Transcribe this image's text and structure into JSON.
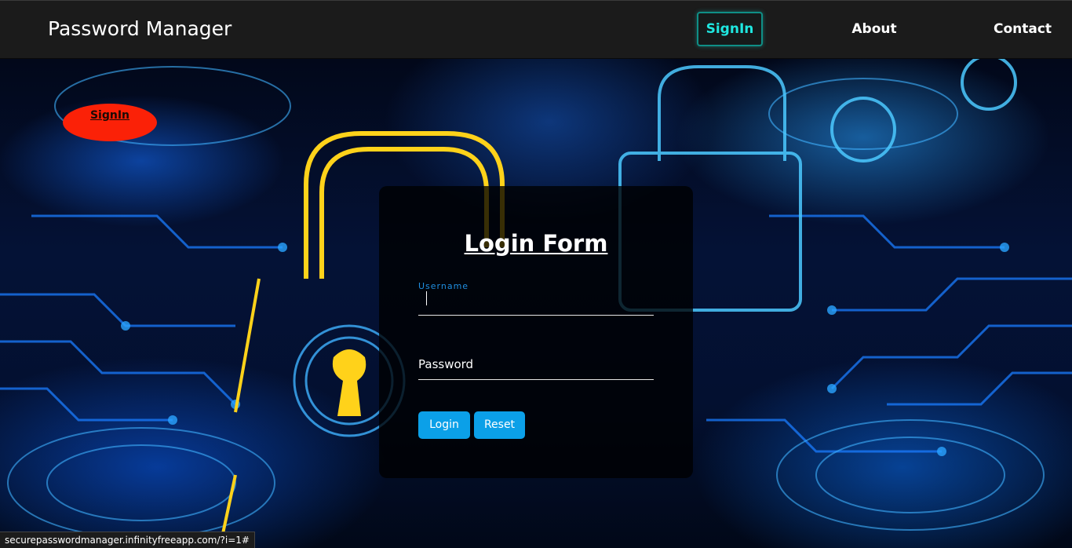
{
  "navbar": {
    "brand": "Password Manager",
    "links": [
      {
        "label": "SignIn",
        "active": true
      },
      {
        "label": "About",
        "active": false
      },
      {
        "label": "Contact",
        "active": false
      }
    ]
  },
  "badge": {
    "label": "SignIn",
    "color": "#fb2107"
  },
  "login_form": {
    "title": "Login Form",
    "username_label": "Username",
    "username_value": "",
    "password_label": "Password",
    "login_button": "Login",
    "reset_button": "Reset"
  },
  "status_bar": {
    "url": "securepasswordmanager.infinityfreeapp.com/?i=1#"
  },
  "colors": {
    "navbar_bg": "#1b1b1b",
    "active_link": "#1fe7e0",
    "button_blue": "#0ba0e8",
    "label_blue": "#1f8fe0",
    "badge_red": "#fb2107"
  },
  "icons": [
    "padlock-illustration"
  ]
}
